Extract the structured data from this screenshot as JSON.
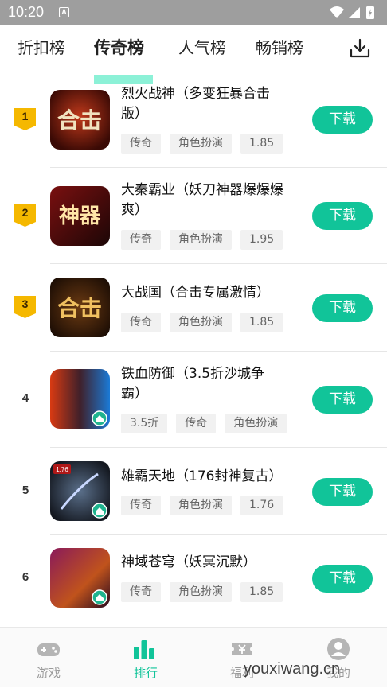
{
  "status_bar": {
    "time": "10:20",
    "notification_glyph": "A"
  },
  "tabs": [
    {
      "label": "折扣榜",
      "active": false
    },
    {
      "label": "传奇榜",
      "active": true
    },
    {
      "label": "人气榜",
      "active": false
    },
    {
      "label": "畅销榜",
      "active": false
    }
  ],
  "header": {
    "download_icon": "download-icon"
  },
  "games": [
    {
      "rank": "1",
      "title_line1": "烈火战神（多变狂暴合击",
      "title_line2": "版）",
      "tags": [
        "传奇",
        "角色扮演",
        "1.85"
      ],
      "button": "下载"
    },
    {
      "rank": "2",
      "title_line1": "大秦霸业（妖刀神器爆爆爆",
      "title_line2": "爽）",
      "tags": [
        "传奇",
        "角色扮演",
        "1.95"
      ],
      "button": "下载"
    },
    {
      "rank": "3",
      "title_line1": "大战国（合击专属激情）",
      "title_line2": "",
      "tags": [
        "传奇",
        "角色扮演",
        "1.85"
      ],
      "button": "下载"
    },
    {
      "rank": "4",
      "title_line1": "铁血防御（3.5折沙城争",
      "title_line2": "霸）",
      "tags": [
        "3.5折",
        "传奇",
        "角色扮演"
      ],
      "button": "下载"
    },
    {
      "rank": "5",
      "title_line1": "雄霸天地（176封神复古）",
      "title_line2": "",
      "tags": [
        "传奇",
        "角色扮演",
        "1.76"
      ],
      "button": "下载"
    },
    {
      "rank": "6",
      "title_line1": "神域苍穹（妖冥沉默）",
      "title_line2": "",
      "tags": [
        "传奇",
        "角色扮演",
        "1.85"
      ],
      "button": "下载"
    }
  ],
  "icon_texts": {
    "g1": "合击",
    "g2": "神器",
    "g3": "合击",
    "g5": "1.76"
  },
  "bottom_nav": [
    {
      "label": "游戏",
      "icon": "gamepad-icon",
      "active": false
    },
    {
      "label": "排行",
      "icon": "ranking-icon",
      "active": true
    },
    {
      "label": "福利",
      "icon": "voucher-icon",
      "active": false
    },
    {
      "label": "我的",
      "icon": "user-icon",
      "active": false
    }
  ],
  "watermark": "youxiwang.cn",
  "colors": {
    "accent": "#11c499",
    "badge": "#f5b800",
    "tab_highlight": "#7ff0d3"
  }
}
